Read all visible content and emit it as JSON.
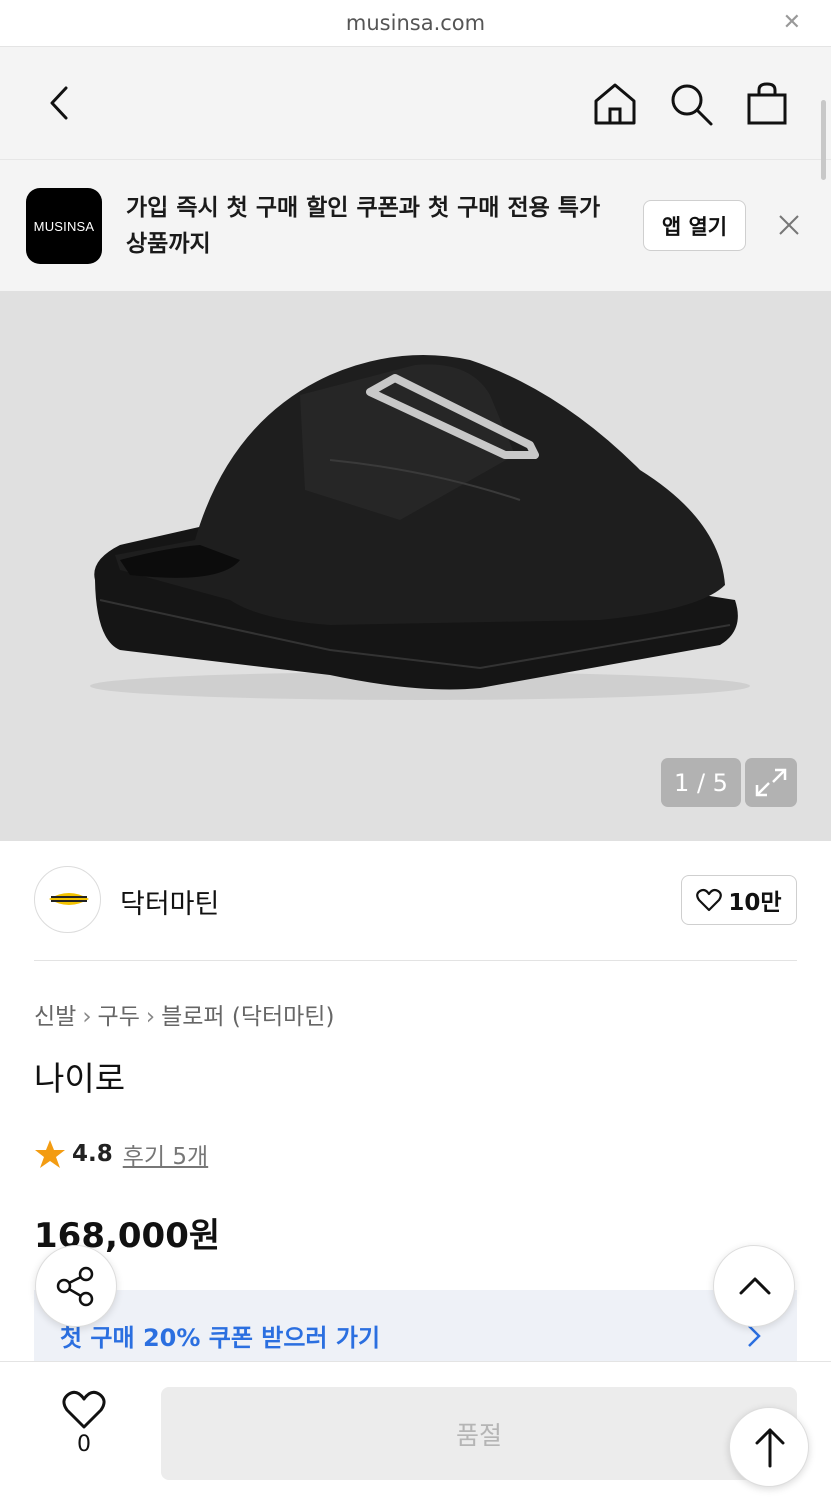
{
  "browser": {
    "url": "musinsa.com"
  },
  "header": {
    "icons": [
      "back-icon",
      "home-icon",
      "search-icon",
      "bag-icon"
    ]
  },
  "app_banner": {
    "logo_text": "MUSINSA",
    "message": "가입 즉시 첫 구매 할인 쿠폰과 첫 구매 전용 특가 상품까지",
    "open_label": "앱 열기"
  },
  "gallery": {
    "counter": "1 / 5",
    "current": 1,
    "total": 5
  },
  "brand": {
    "name": "닥터마틴",
    "likes": "10만"
  },
  "product": {
    "breadcrumb": [
      "신발",
      "구두",
      "블로퍼 (닥터마틴)"
    ],
    "name": "나이로",
    "rating": "4.8",
    "reviews": "후기 5개",
    "price": "168,000원"
  },
  "coupon": {
    "label": "첫 구매 20% 쿠폰 받으러 가기"
  },
  "bottom_bar": {
    "wish_count": "0",
    "buy_label": "품절"
  },
  "colors": {
    "coupon_text": "#2b6fe0",
    "star": "#f39c12",
    "soldout_bg": "#ececec"
  }
}
